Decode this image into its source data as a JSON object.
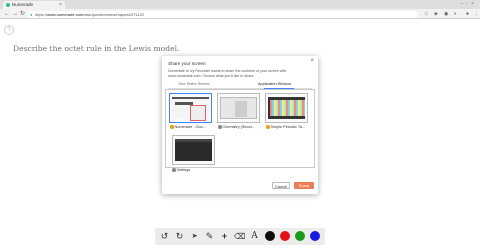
{
  "browser": {
    "tab_title": "Numerade",
    "url_prefix": "https://",
    "url_host": "www.numerade.com",
    "url_path": "/ask/question/new/request/371120"
  },
  "question": {
    "text": "Describe the octet rule in the Lewis model.",
    "help_label": "?"
  },
  "dialog": {
    "title": "Share your screen",
    "description": "Numerade to Ivy Recorder wants to share the contents of your screen with www.numerade.com. Choose what you'd like to share.",
    "tabs": [
      {
        "label": "Your Entire Screen"
      },
      {
        "label": "Application Window"
      }
    ],
    "windows": [
      {
        "label": "Numerade - Goo...",
        "icon": "chrome-icon",
        "selected": true
      },
      {
        "label": "Chemistry (Struct...",
        "icon": "pdf-icon"
      },
      {
        "label": "Simple Periodic Ta...",
        "icon": "chrome-icon"
      },
      {
        "label": "Settings",
        "icon": "settings-icon"
      }
    ],
    "cancel_label": "Cancel",
    "share_label": "Share"
  },
  "drawing_tools": [
    {
      "name": "undo-icon",
      "glyph": "↺"
    },
    {
      "name": "redo-icon",
      "glyph": "↻"
    },
    {
      "name": "pointer-icon",
      "glyph": "➤"
    },
    {
      "name": "pen-icon",
      "glyph": "✎"
    },
    {
      "name": "plus-icon",
      "glyph": "+"
    },
    {
      "name": "eraser-icon",
      "glyph": "⌫"
    },
    {
      "name": "text-icon",
      "glyph": "A"
    }
  ],
  "drawing_colors": [
    "#111111",
    "#e8101a",
    "#1a9a1a",
    "#1a1ae8"
  ]
}
